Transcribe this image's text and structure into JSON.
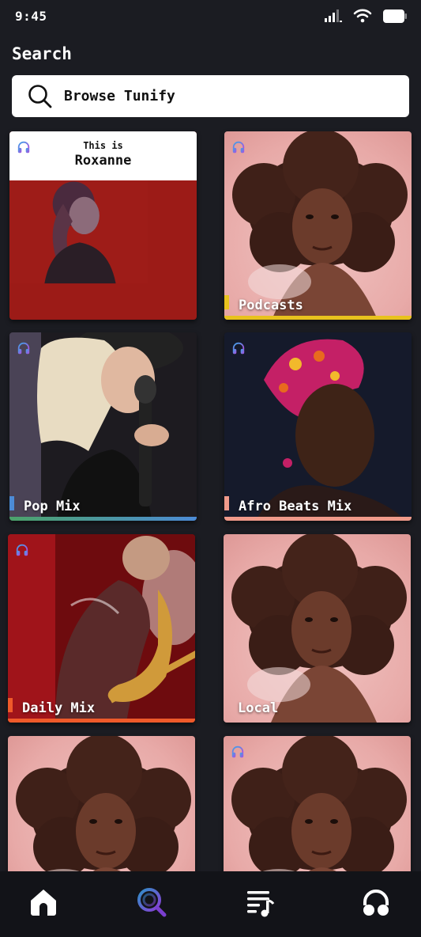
{
  "status": {
    "time": "9:45"
  },
  "page": {
    "title": "Search"
  },
  "search": {
    "placeholder": "Browse Tunify"
  },
  "cards": [
    {
      "this_is": "This is",
      "artist": "Roxanne"
    },
    {
      "label": "Podcasts",
      "accent": "#e8c21e"
    },
    {
      "label": "Pop Mix",
      "accent": "#4c8bd6"
    },
    {
      "label": "Afro Beats Mix",
      "accent": "#f09a8a"
    },
    {
      "label": "Daily Mix",
      "accent": "#ef5a2a"
    },
    {
      "label": "Local"
    },
    {
      "label": ""
    },
    {
      "label": ""
    }
  ],
  "nav": {
    "items": [
      {
        "icon": "home-icon"
      },
      {
        "icon": "search-icon",
        "active_color": "#7b3fd0"
      },
      {
        "icon": "playlist-icon"
      },
      {
        "icon": "headphones-icon"
      }
    ]
  }
}
